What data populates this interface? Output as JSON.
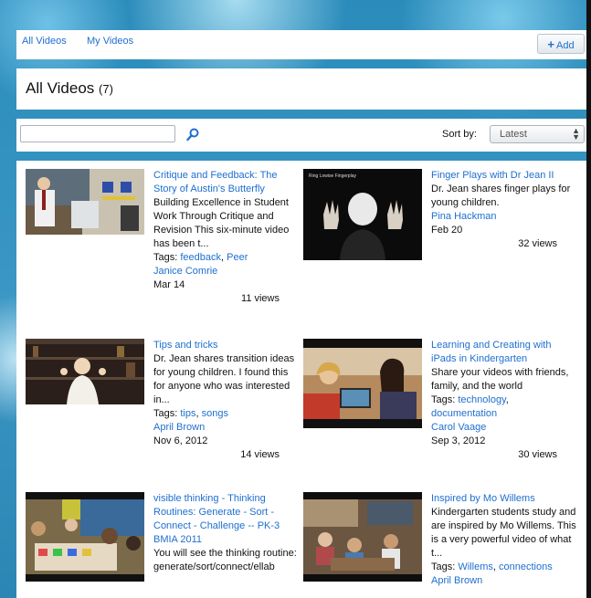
{
  "nav": {
    "all_videos": "All Videos",
    "my_videos": "My Videos",
    "add": "Add"
  },
  "header": {
    "title": "All Videos",
    "count": "(7)"
  },
  "toolbar": {
    "search_value": "",
    "sort_label": "Sort by:",
    "sort_value": "Latest"
  },
  "videos": [
    {
      "title": "Critique and Feedback: The Story of Austin's Butterfly",
      "description": "Building Excellence in Student Work Through Critique and Revision This six-minute video has been t...",
      "tags_label": "Tags:",
      "tag1": "feedback",
      "tag2": "Peer",
      "author": "Janice Comrie",
      "date": "Mar 14",
      "views": "11 views"
    },
    {
      "title": "Finger Plays with Dr Jean II",
      "thumb_caption": "Ring Lowise Fingerplay",
      "description": "Dr. Jean shares finger plays for young children.",
      "author": "Pina Hackman",
      "date": "Feb 20",
      "views": "32 views"
    },
    {
      "title": "Tips and tricks",
      "description": "Dr. Jean shares transition ideas for young children. I found this for anyone who was interested in...",
      "tags_label": "Tags:",
      "tag1": "tips",
      "tag2": "songs",
      "author": "April Brown",
      "date": "Nov 6, 2012",
      "views": "14 views"
    },
    {
      "title": "Learning and Creating with iPads in Kindergarten",
      "description": "Share your videos with friends, family, and the world",
      "tags_label": "Tags:",
      "tag1": "technology",
      "tag2": "documentation",
      "author": "Carol Vaage",
      "date": "Sep 3, 2012",
      "views": "30 views"
    },
    {
      "title": "visible thinking - Thinking Routines: Generate - Sort - Connect - Challenge -- PK-3 BMIA 2011",
      "description": "You will see the thinking routine: generate/sort/connect/ellab"
    },
    {
      "title": "Inspired by Mo Willems",
      "description": "Kindergarten students study and are inspired by Mo Willems. This is a very powerful video of what t...",
      "tags_label": "Tags:",
      "tag1": "Willems",
      "tag2": "connections",
      "author": "April Brown"
    }
  ]
}
